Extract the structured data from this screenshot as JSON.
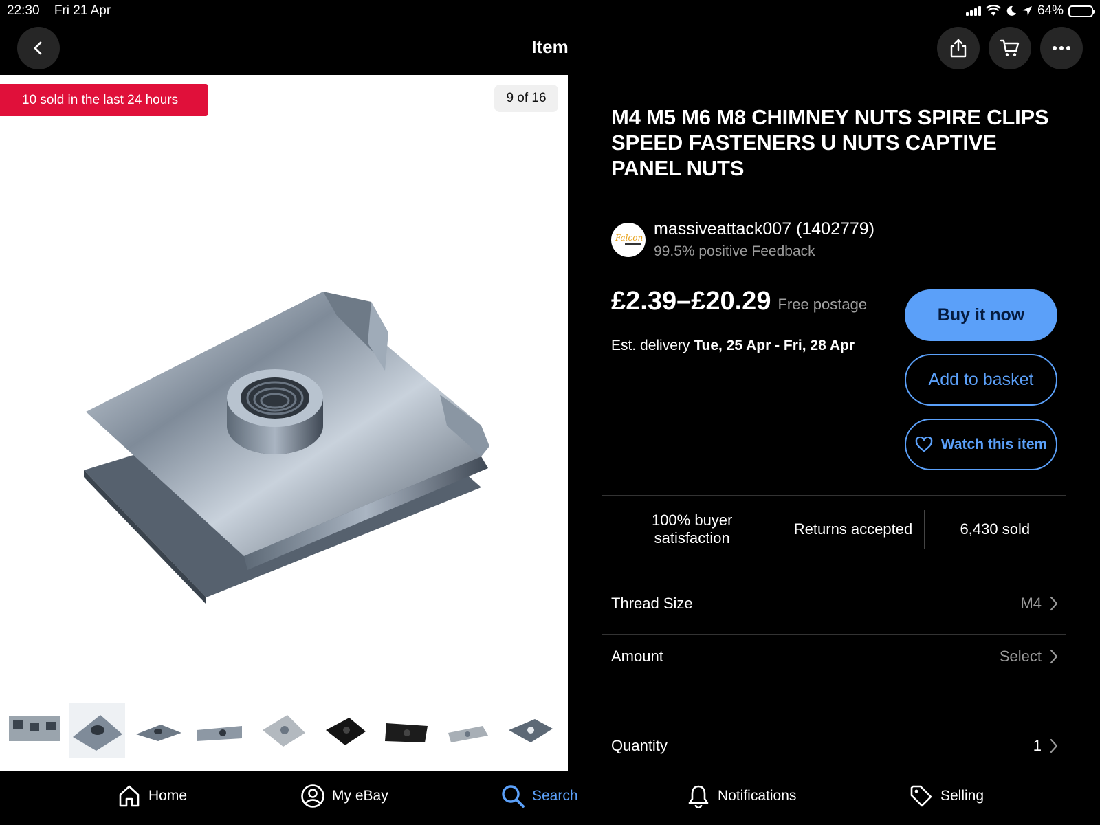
{
  "status_bar": {
    "time": "22:30",
    "date": "Fri 21 Apr",
    "battery": "64%",
    "battery_level": 0.64
  },
  "nav": {
    "title": "Item"
  },
  "gallery": {
    "badge": "10 sold in the last 24 hours",
    "counter": "9 of 16",
    "thumbnail_count": 9
  },
  "item": {
    "title": "M4 M5 M6 M8 CHIMNEY NUTS SPIRE CLIPS SPEED FASTENERS U NUTS CAPTIVE PANEL NUTS",
    "seller_name": "massiveattack007 (1402779)",
    "seller_feedback": "99.5% positive Feedback",
    "seller_logo_text": "Falcon",
    "price": "£2.39–£20.29",
    "postage": "Free postage",
    "delivery_label": "Est. delivery",
    "delivery_dates": "Tue, 25 Apr - Fri, 28 Apr"
  },
  "actions": {
    "buy": "Buy it now",
    "basket": "Add to basket",
    "watch": "Watch this item"
  },
  "stats": {
    "satisfaction": "100% buyer satisfaction",
    "returns": "Returns accepted",
    "sold": "6,430 sold"
  },
  "options": {
    "thread_size_label": "Thread Size",
    "thread_size_value": "M4",
    "amount_label": "Amount",
    "amount_value": "Select",
    "quantity_label": "Quantity",
    "quantity_value": "1"
  },
  "tabs": {
    "home": "Home",
    "my_ebay": "My eBay",
    "search": "Search",
    "notifications": "Notifications",
    "selling": "Selling"
  },
  "colors": {
    "accent": "#5ba0f9",
    "badge": "#e0103a",
    "background": "#000000"
  }
}
